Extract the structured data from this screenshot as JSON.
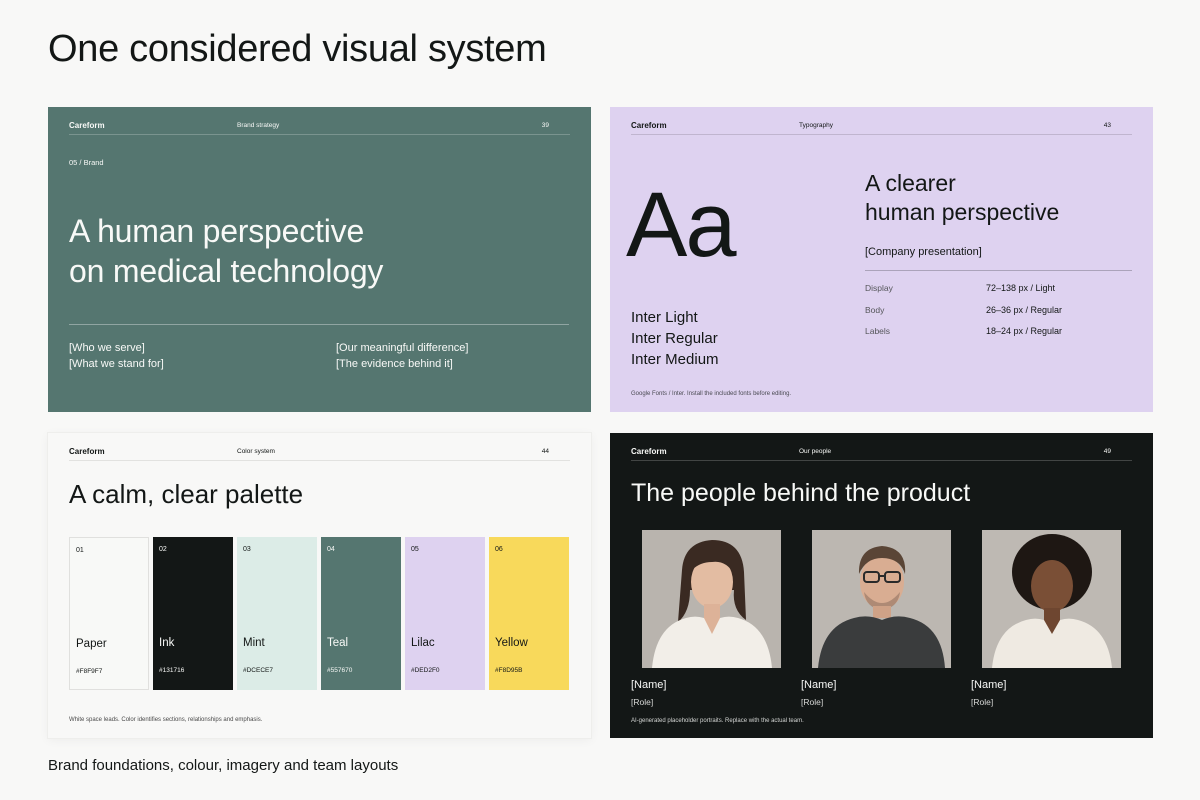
{
  "page": {
    "title": "One considered visual system",
    "caption": "Brand foundations, colour, imagery and team layouts"
  },
  "slides": {
    "brand": {
      "brand": "Careform",
      "section": "Brand strategy",
      "page_number": "39",
      "eyebrow": "05 / Brand",
      "headline_line1": "A human perspective",
      "headline_line2": "on medical technology",
      "links_left": [
        "[Who we serve]",
        "[What we stand for]"
      ],
      "links_right": [
        "[Our meaningful difference]",
        "[The evidence behind it]"
      ]
    },
    "typography": {
      "brand": "Careform",
      "section": "Typography",
      "page_number": "43",
      "specimen": "Aa",
      "weights": [
        "Inter Light",
        "Inter Regular",
        "Inter Medium"
      ],
      "headline_line1": "A clearer",
      "headline_line2": "human perspective",
      "tag": "[Company presentation]",
      "specs": [
        {
          "label": "Display",
          "value": "72–138 px / Light"
        },
        {
          "label": "Body",
          "value": "26–36 px / Regular"
        },
        {
          "label": "Labels",
          "value": "18–24 px / Regular"
        }
      ],
      "note": "Google Fonts / Inter. Install the included fonts before editing."
    },
    "color": {
      "brand": "Careform",
      "section": "Color system",
      "page_number": "44",
      "headline": "A calm, clear palette",
      "swatches": [
        {
          "num": "01",
          "name": "Paper",
          "hex": "#F8F9F7"
        },
        {
          "num": "02",
          "name": "Ink",
          "hex": "#131716"
        },
        {
          "num": "03",
          "name": "Mint",
          "hex": "#DCECE7"
        },
        {
          "num": "04",
          "name": "Teal",
          "hex": "#557670"
        },
        {
          "num": "05",
          "name": "Lilac",
          "hex": "#DED2F0"
        },
        {
          "num": "06",
          "name": "Yellow",
          "hex": "#F8D95B"
        }
      ],
      "note": "White space leads. Color identifies sections, relationships and emphasis."
    },
    "people": {
      "brand": "Careform",
      "section": "Our people",
      "page_number": "49",
      "headline": "The people behind the product",
      "members": [
        {
          "name": "[Name]",
          "role": "[Role]",
          "portrait": "woman-portrait"
        },
        {
          "name": "[Name]",
          "role": "[Role]",
          "portrait": "man-portrait"
        },
        {
          "name": "[Name]",
          "role": "[Role]",
          "portrait": "woman-portrait"
        }
      ],
      "note": "AI-generated placeholder portraits. Replace with the actual team."
    }
  },
  "colors": {
    "paper": "#F8F9F7",
    "ink": "#131716",
    "mint": "#DCECE7",
    "teal": "#557670",
    "lilac": "#DED2F0",
    "yellow": "#F8D95B"
  }
}
